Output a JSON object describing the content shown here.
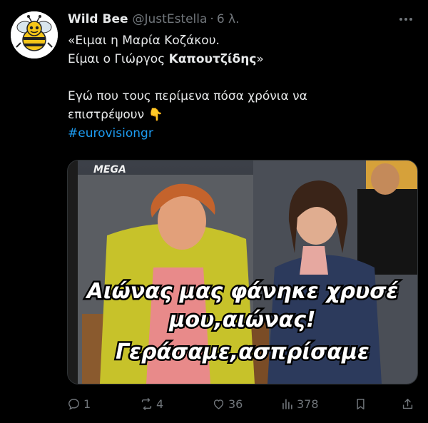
{
  "tweet": {
    "display_name": "Wild Bee",
    "handle": "@JustEstella",
    "separator": "·",
    "time": "6 λ.",
    "more_icon": "more-dots-icon",
    "lines": [
      "«Ειμαι η Μαρία Κοζάκου.",
      "Είμαι ο Γιώργος ",
      "",
      "Εγώ που τους περίμενα πόσα χρόνια να",
      "επιστρέψουν 👇"
    ],
    "bold_name": "Καπουτζίδης",
    "line2_end": "»",
    "hashtag": "#eurovisiongr"
  },
  "media": {
    "channel_logo": "MEGA",
    "caption_line1": "Αιώνας μας φάνηκε χρυσέ",
    "caption_line2": "μου,αιώνας!",
    "caption_line3": "Γεράσαμε,ασπρίσαμε"
  },
  "actions": {
    "replies": "1",
    "reposts": "4",
    "likes": "36",
    "views": "378"
  }
}
